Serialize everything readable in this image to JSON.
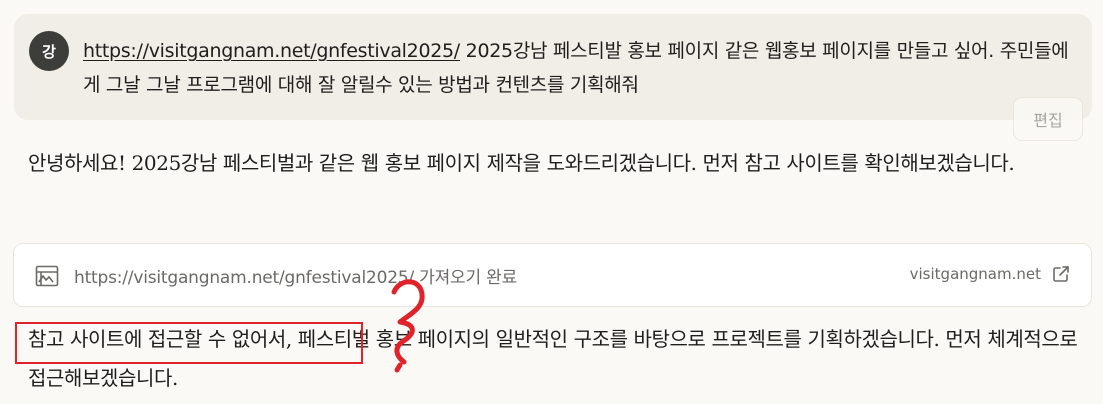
{
  "user_message": {
    "avatar_initial": "강",
    "link_text": "https://visitgangnam.net/gnfestival2025/",
    "text": " 2025강남 페스티발 홍보 페이지 같은 웹홍보 페이지를 만들고 싶어. 주민들에게 그날 그날 프로그램에 대해 잘 알릴수 있는 방법과 컨텐츠를 기획해줘",
    "edit_label": "편집"
  },
  "assistant": {
    "paragraph1": "안녕하세요! 2025강남 페스티벌과 같은 웹 홍보 페이지 제작을 도와드리겠습니다. 먼저 참고 사이트를 확인해보겠습니다.",
    "fetch_card": {
      "label": "https://visitgangnam.net/gnfestival2025/ 가져오기 완료",
      "domain": "visitgangnam.net"
    },
    "paragraph2": "참고 사이트에 접근할 수 없어서, 페스티벌 홍보 페이지의 일반적인 구조를 바탕으로 프로젝트를 기획하겠습니다. 먼저 체계적으로 접근해보겠습니다."
  },
  "annotation": {
    "color": "#e0232a"
  },
  "icons": {
    "fetch": "web-page-icon",
    "external": "external-link-icon"
  }
}
